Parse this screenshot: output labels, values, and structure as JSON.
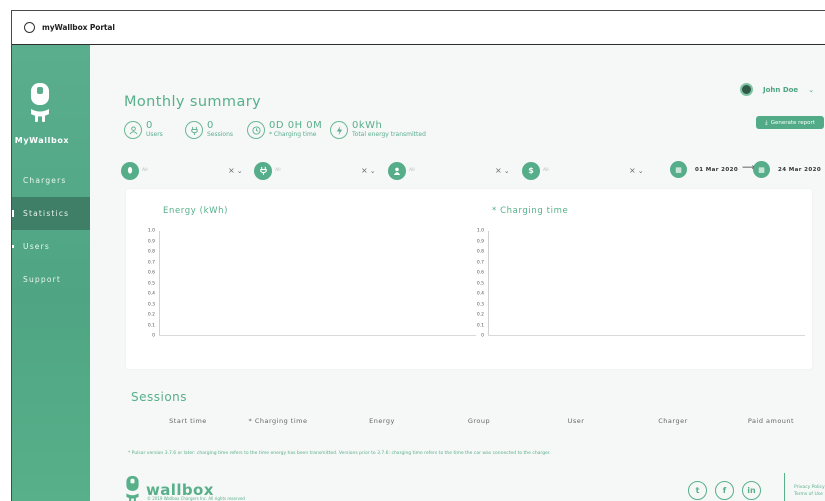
{
  "window": {
    "title": "myWallbox Portal"
  },
  "sidebar": {
    "brand": "MyWallbox",
    "items": [
      {
        "label": "Chargers",
        "active": false
      },
      {
        "label": "Statistics",
        "active": true
      },
      {
        "label": "Users",
        "active": false
      },
      {
        "label": "Support",
        "active": false
      }
    ]
  },
  "header": {
    "title": "Monthly summary",
    "user_name": "John Doe",
    "generate_report_label": "Generate report"
  },
  "stats": {
    "users": {
      "value": "0",
      "label": "Users",
      "icon": "user-icon"
    },
    "sessions": {
      "value": "0",
      "label": "Sessions",
      "icon": "plug-icon"
    },
    "charging_time": {
      "value": "0D 0H 0M",
      "label": "* Charging time",
      "icon": "clock-icon"
    },
    "energy": {
      "value": "0kWh",
      "label": "Total energy transmitted",
      "icon": "bolt-icon"
    }
  },
  "filters": [
    {
      "icon": "charger-icon",
      "value": "All"
    },
    {
      "icon": "plug-icon",
      "value": "All"
    },
    {
      "icon": "user-icon",
      "value": "All"
    },
    {
      "icon": "dollar-icon",
      "value": "All"
    }
  ],
  "date_range": {
    "start": "01 Mar 2020",
    "end": "24 Mar 2020"
  },
  "chart_data": [
    {
      "type": "bar",
      "title": "Energy (kWh)",
      "categories": [],
      "values": [],
      "ylim": [
        0,
        1
      ],
      "yticks": [
        "1.0",
        "0.9",
        "0.8",
        "0.7",
        "0.6",
        "0.5",
        "0.4",
        "0.3",
        "0.2",
        "0.1",
        "0"
      ]
    },
    {
      "type": "bar",
      "title": "* Charging time",
      "categories": [],
      "values": [],
      "ylim": [
        0,
        1
      ],
      "yticks": [
        "1.0",
        "0.9",
        "0.8",
        "0.7",
        "0.6",
        "0.5",
        "0.4",
        "0.3",
        "0.2",
        "0.1",
        "0"
      ]
    }
  ],
  "sessions": {
    "title": "Sessions",
    "columns": [
      "Start time",
      "* Charging time",
      "Energy",
      "Group",
      "User",
      "Charger",
      "Paid amount"
    ]
  },
  "footnote": "* Pulsar version 3.7.6 or later: charging time refers to the time energy has been transmitted. Versions prior to 3.7.6: charging time refers to the time the car was connected to the charger.",
  "footer": {
    "logo_text": "wallbox",
    "copyright": "© 2019 Wallbox Chargers Inc. All rights reserved",
    "privacy": "Privacy Policy",
    "terms": "Terms of Use",
    "social": [
      {
        "icon": "twitter-icon",
        "glyph": "t"
      },
      {
        "icon": "facebook-icon",
        "glyph": "f"
      },
      {
        "icon": "linkedin-icon",
        "glyph": "in"
      }
    ]
  },
  "colors": {
    "brand": "#57b08a",
    "sidebar_active": "#3f7f68"
  }
}
